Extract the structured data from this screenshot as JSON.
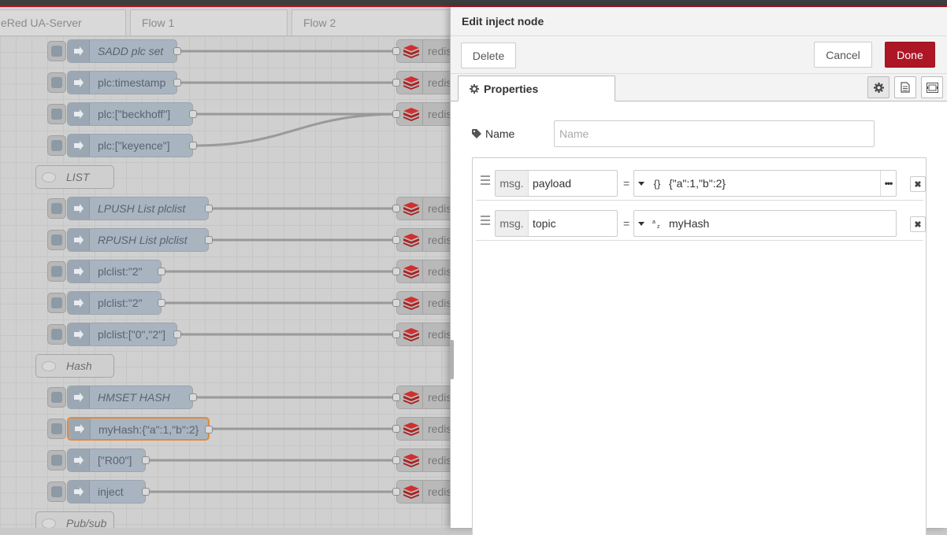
{
  "workspace": {
    "tabs": [
      {
        "label": "eRed UA-Server"
      },
      {
        "label": "Flow 1"
      },
      {
        "label": "Flow 2"
      }
    ],
    "nodes": [
      {
        "label": "SADD plc set",
        "italic": true
      },
      {
        "label": "plc:timestamp",
        "italic": false
      },
      {
        "label": "plc:[\"beckhoff\"]",
        "italic": false
      },
      {
        "label": "plc:[\"keyence\"]",
        "italic": false
      },
      {
        "label": "LPUSH List plclist",
        "italic": true
      },
      {
        "label": "RPUSH List plclist",
        "italic": true
      },
      {
        "label": "plclist:\"2\"",
        "italic": false
      },
      {
        "label": "plclist:\"2\"",
        "italic": false
      },
      {
        "label": "plclist:[\"0\",\"2\"]",
        "italic": false
      },
      {
        "label": "HMSET HASH",
        "italic": true
      },
      {
        "label": "myHash:{\"a\":1,\"b\":2}",
        "italic": false
      },
      {
        "label": "[\"R00\"]",
        "italic": false
      },
      {
        "label": "inject",
        "italic": false
      }
    ],
    "comments": [
      {
        "label": "LIST"
      },
      {
        "label": "Hash"
      },
      {
        "label": "Pub/sub"
      }
    ],
    "redis_label": "redis"
  },
  "tray": {
    "title": "Edit inject node",
    "delete_label": "Delete",
    "cancel_label": "Cancel",
    "done_label": "Done",
    "properties_tab": "Properties",
    "name_label": "Name",
    "name_placeholder": "Name",
    "properties": [
      {
        "prefix": "msg.",
        "key": "payload",
        "eq": "=",
        "type_icon": "{}",
        "value": "{\"a\":1,\"b\":2}",
        "has_more": true
      },
      {
        "prefix": "msg.",
        "key": "topic",
        "eq": "=",
        "type_icon": "az",
        "value": "myHash",
        "has_more": false
      }
    ]
  },
  "colors": {
    "accent": "#ad1625",
    "node": "#a8b4c0",
    "selected_border": "#e28a3b"
  }
}
